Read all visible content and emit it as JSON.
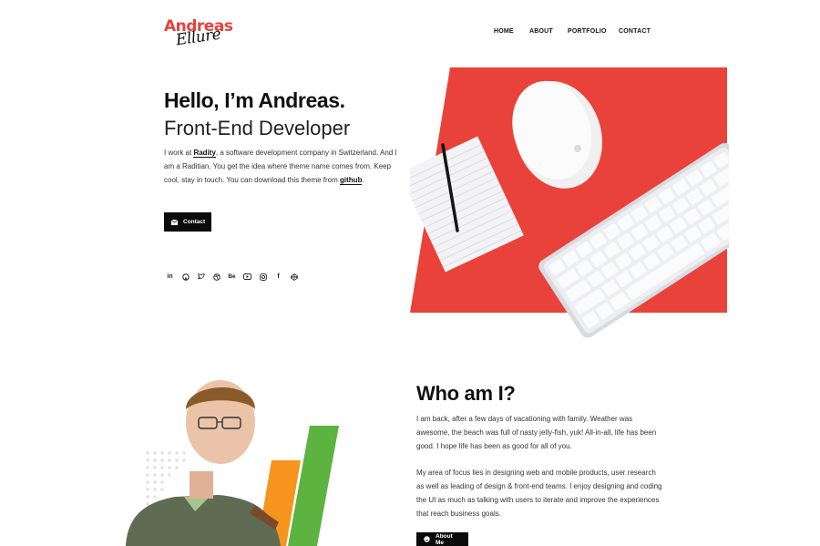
{
  "header": {
    "logo_line1": "Andreas",
    "logo_line2": "Ellure",
    "nav": [
      "HOME",
      "ABOUT",
      "PORTFOLIO",
      "CONTACT"
    ]
  },
  "hero": {
    "title": "Hello, I’m Andreas.",
    "subtitle": "Front-End Developer",
    "desc_pre": "I work at ",
    "company": "Radity",
    "desc_mid": ", a software development company in Switzerland. And I am a Raditian. You get the idea where theme name comes from. Keep cool, stay in touch. You can download this theme from ",
    "github": "github",
    "desc_end": ".",
    "contact_button": "Contact",
    "socials": [
      "linkedin-icon",
      "github-icon",
      "twitter-icon",
      "dribbble-icon",
      "behance-icon",
      "youtube-icon",
      "instagram-icon",
      "facebook-icon",
      "codepen-icon"
    ]
  },
  "about": {
    "title": "Who am I?",
    "paragraph1": "I am back, after a few days of vacationing with family. Weather was awesome, the beach was full of nasty jelly-fish, yuk! All-in-all, life has been good. I hope life has been as good for all of you.",
    "paragraph2": "My area of focus lies in designing web and mobile products, user research as well as leading of design & front-end teams. I enjoy designing and coding the UI as much as talking with users to iterate and improve the experiences that reach business goals.",
    "about_button": "About Me"
  },
  "colors": {
    "accent": "#e8423a",
    "dark": "#0b0b0b",
    "green": "#5db33f",
    "orange": "#f7941d"
  }
}
